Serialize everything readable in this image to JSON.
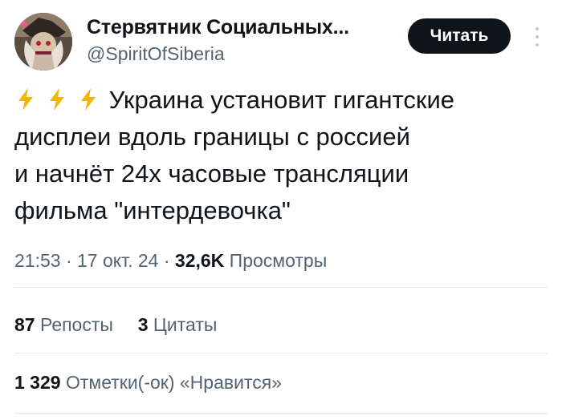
{
  "author": {
    "name": "Стервятник Социальных...",
    "handle": "@SpiritOfSiberia"
  },
  "actions": {
    "follow_label": "Читать"
  },
  "tweet": {
    "emoji": [
      "⚡",
      "⚡",
      "⚡"
    ],
    "text": "Украина установит гигантские\nдисплеи вдоль границы с россией\nи начнёт 24х часовые трансляции\nфильма \"интердевочка\""
  },
  "meta": {
    "time": "21:53",
    "date": "17 окт. 24",
    "separator": "·",
    "views_count": "32,6K",
    "views_label": "Просмотры"
  },
  "stats": {
    "reposts_count": "87",
    "reposts_label": "Репосты",
    "quotes_count": "3",
    "quotes_label": "Цитаты",
    "likes_count": "1 329",
    "likes_label": "Отметки(-ок) «Нравится»"
  },
  "colors": {
    "text": "#0f1419",
    "secondary": "#536471",
    "button_bg": "#0f1419",
    "divider": "#e6eaed",
    "emoji": "#f4b400"
  }
}
